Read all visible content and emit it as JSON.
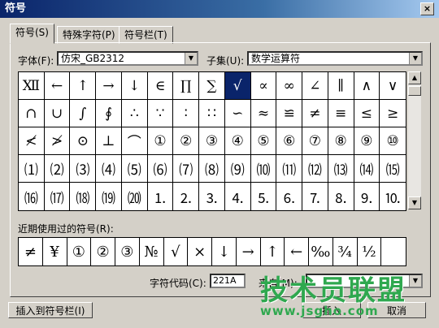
{
  "window": {
    "title": "符号",
    "close_glyph": "×"
  },
  "tabs": [
    {
      "label": "符号(S)",
      "active": true
    },
    {
      "label": "特殊字符(P)",
      "active": false
    },
    {
      "label": "符号栏(T)",
      "active": false
    }
  ],
  "font": {
    "label": "字体(F):",
    "value": "仿宋_GB2312"
  },
  "subset": {
    "label": "子集(U):",
    "value": "数学运算符"
  },
  "symbols": [
    "Ⅻ",
    "←",
    "↑",
    "→",
    "↓",
    "∈",
    "∏",
    "∑",
    "√",
    "∝",
    "∞",
    "∠",
    "∥",
    "∧",
    "∨",
    "∩",
    "∪",
    "∫",
    "∮",
    "∴",
    "∵",
    "∶",
    "∷",
    "∽",
    "≈",
    "≌",
    "≠",
    "≡",
    "≤",
    "≥",
    "≮",
    "≯",
    "⊙",
    "⊥",
    "⌒",
    "①",
    "②",
    "③",
    "④",
    "⑤",
    "⑥",
    "⑦",
    "⑧",
    "⑨",
    "⑩",
    "⑴",
    "⑵",
    "⑶",
    "⑷",
    "⑸",
    "⑹",
    "⑺",
    "⑻",
    "⑼",
    "⑽",
    "⑾",
    "⑿",
    "⒀",
    "⒁",
    "⒂",
    "⒃",
    "⒄",
    "⒅",
    "⒆",
    "⒇",
    "⒈",
    "⒉",
    "⒊",
    "⒋",
    "⒌",
    "⒍",
    "⒎",
    "⒏",
    "⒐",
    "⒑"
  ],
  "selected_index": 8,
  "recent": {
    "label": "近期使用过的符号(R):",
    "items": [
      "≠",
      "¥",
      "①",
      "②",
      "③",
      "№",
      "√",
      "×",
      "↓",
      "→",
      "↑",
      "←",
      "‰",
      "¾",
      "½",
      ""
    ]
  },
  "code": {
    "label": "字符代码(C):",
    "value": "221A",
    "from_label": "来自(M):"
  },
  "buttons": {
    "insert_to_bar": "插入到符号栏(I)",
    "insert": "插入",
    "cancel": "取消"
  },
  "watermark": {
    "text": "技术员联盟",
    "url": "www.jsgho.com"
  },
  "colors": {
    "title_bar": "#0a246a",
    "selection": "#0a246a",
    "watermark": "#2fa84f"
  }
}
